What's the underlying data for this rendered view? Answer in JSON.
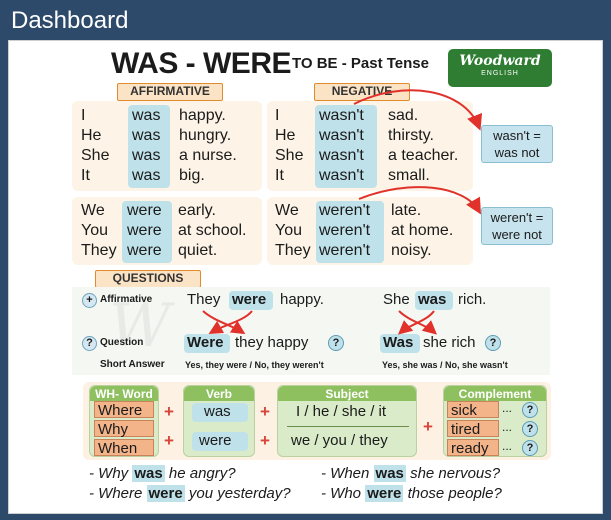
{
  "app": {
    "title": "Dashboard"
  },
  "poster": {
    "title": "WAS - WERE",
    "subtitle": "TO BE - Past Tense",
    "logo": {
      "name": "Woodward",
      "sub": "ENGLISH"
    },
    "labels": {
      "affirmative": "AFFIRMATIVE",
      "negative": "NEGATIVE",
      "questions": "QUESTIONS"
    },
    "affirmative_singular": {
      "pronouns": [
        "I",
        "He",
        "She",
        "It"
      ],
      "verb": [
        "was",
        "was",
        "was",
        "was"
      ],
      "rest": [
        "happy.",
        "hungry.",
        "a nurse.",
        "big."
      ]
    },
    "negative_singular": {
      "pronouns": [
        "I",
        "He",
        "She",
        "It"
      ],
      "verb": [
        "wasn't",
        "wasn't",
        "wasn't",
        "wasn't"
      ],
      "rest": [
        "sad.",
        "thirsty.",
        "a teacher.",
        "small."
      ]
    },
    "affirmative_plural": {
      "pronouns": [
        "We",
        "You",
        "They"
      ],
      "verb": [
        "were",
        "were",
        "were"
      ],
      "rest": [
        "early.",
        "at school.",
        "quiet."
      ]
    },
    "negative_plural": {
      "pronouns": [
        "We",
        "You",
        "They"
      ],
      "verb": [
        "weren't",
        "weren't",
        "weren't"
      ],
      "rest": [
        "late.",
        "at home.",
        "noisy."
      ]
    },
    "notes": {
      "wasnt": [
        "wasn't =",
        "was not"
      ],
      "werent": [
        "weren't =",
        "were not"
      ]
    },
    "questions": {
      "plus_icon": "+",
      "affirmative_label": "Affirmative",
      "question_icon": "?",
      "question_label": "Question",
      "short_answer_label": "Short Answer",
      "left": {
        "aff_subject": "They",
        "aff_verb": "were",
        "aff_rest": "happy.",
        "q_verb": "Were",
        "q_rest": "they happy",
        "q_mark": "?",
        "short": "Yes, they were / No, they weren't"
      },
      "right": {
        "aff_subject": "She",
        "aff_verb": "was",
        "aff_rest": "rich.",
        "q_verb": "Was",
        "q_rest": "she rich",
        "q_mark": "?",
        "short": "Yes, she was / No, she wasn't"
      }
    },
    "formula": {
      "wh_header": "WH- Word",
      "wh_words": [
        "Where",
        "Why",
        "When"
      ],
      "verb_header": "Verb",
      "verbs": [
        "was",
        "were"
      ],
      "subject_header": "Subject",
      "subjects": [
        "I / he / she / it",
        "we / you / they"
      ],
      "complement_header": "Complement",
      "complements": [
        "sick",
        "tired",
        "ready"
      ],
      "ellipsis": "...",
      "q_mark": "?"
    },
    "examples": [
      {
        "pre": "- Why",
        "verb": "was",
        "post": "he angry?"
      },
      {
        "pre": "- When",
        "verb": "was",
        "post": "she nervous?"
      },
      {
        "pre": "- Where",
        "verb": "were",
        "post": "you yesterday?"
      },
      {
        "pre": "- Who",
        "verb": "were",
        "post": "those people?"
      }
    ],
    "colors": {
      "header_bg": "#2e4a6b",
      "highlight_blue": "#bfe1ea",
      "tag_orange": "#e08b2e",
      "arrow_red": "#e0322b",
      "formula_green": "#d9ebc8",
      "formula_header_green": "#8fc060",
      "complement_orange": "#f3b48a"
    }
  }
}
